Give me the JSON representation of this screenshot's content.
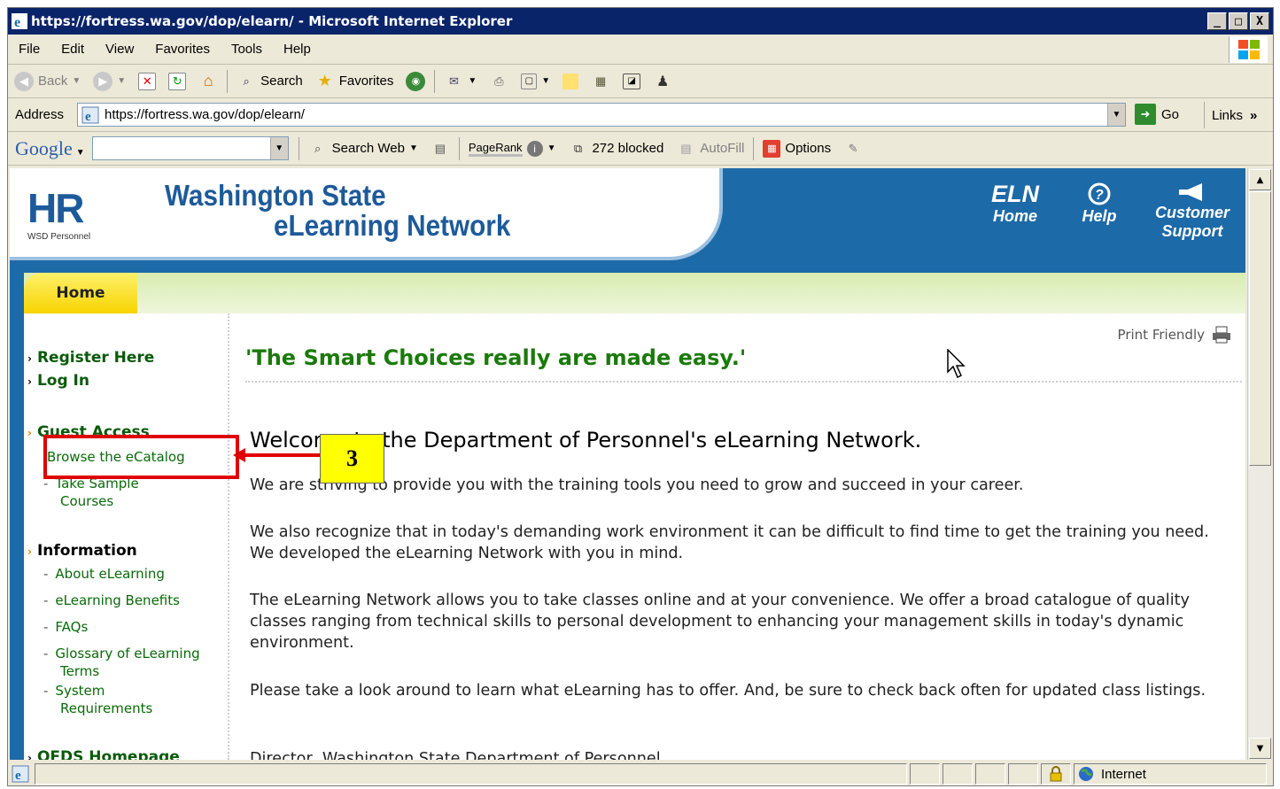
{
  "window": {
    "title": "https://fortress.wa.gov/dop/elearn/ - Microsoft Internet Explorer",
    "minimize": "_",
    "maximize": "□",
    "close": "X"
  },
  "menu": [
    "File",
    "Edit",
    "View",
    "Favorites",
    "Tools",
    "Help"
  ],
  "toolbar": {
    "back": "Back",
    "search": "Search",
    "favorites": "Favorites"
  },
  "address": {
    "label": "Address",
    "url": "https://fortress.wa.gov/dop/elearn/",
    "go": "Go",
    "links": "Links",
    "more": "»"
  },
  "google": {
    "logo": "Google",
    "search_web": "Search Web",
    "pagerank": "PageRank",
    "blocked": "272 blocked",
    "autofill": "AutoFill",
    "options": "Options"
  },
  "site": {
    "logo": "HR",
    "logo_sub": "WSD Personnel",
    "title_line1": "Washington State",
    "title_line2": "eLearning Network",
    "nav": {
      "eln_1": "ELN",
      "eln_2": "Home",
      "help_2": "Help",
      "support_1": "Customer",
      "support_2": "Support"
    },
    "tab_home": "Home"
  },
  "sidebar": {
    "register": "Register Here",
    "login": "Log In",
    "guest": "Guest Access",
    "browse": "Browse the eCatalog",
    "sample_1": "Take Sample",
    "sample_2": "Courses",
    "information": "Information",
    "about": "About eLearning",
    "benefits": "eLearning Benefits",
    "faqs": "FAQs",
    "glossary_1": "Glossary of eLearning",
    "glossary_2": "Terms",
    "sysreq_1": "System",
    "sysreq_2": "Requirements",
    "ofds": "OFDS Homepage"
  },
  "callout": {
    "number": "3"
  },
  "main": {
    "print_friendly": "Print Friendly",
    "quote": "'The Smart Choices really are made easy.'",
    "welcome": "Welcome to the Department of Personnel's eLearning Network.",
    "p1": "We are striving to provide you with the training tools you need to grow and succeed in your career.",
    "p2": "We also recognize that in today's demanding work environment it can be difficult to find time to get the training you need. We developed the eLearning Network with you in mind.",
    "p3": "The eLearning Network allows you to take classes online and at your convenience. We offer a broad catalogue of quality classes ranging from technical skills to personal development to enhancing your management skills in today's dynamic environment.",
    "p4": "Please take a look around to learn what eLearning has to offer. And, be sure to check back often for updated class listings.",
    "signature": "Director, Washington State Department of Personnel"
  },
  "status": {
    "zone": "Internet"
  },
  "colors": {
    "titlebar": "#0a246a",
    "banner": "#1d6aa8",
    "link_green": "#0a5a0a",
    "quote_green": "#1a7a0a",
    "highlight_red": "#e00000",
    "callout_yellow": "#ffff00"
  }
}
